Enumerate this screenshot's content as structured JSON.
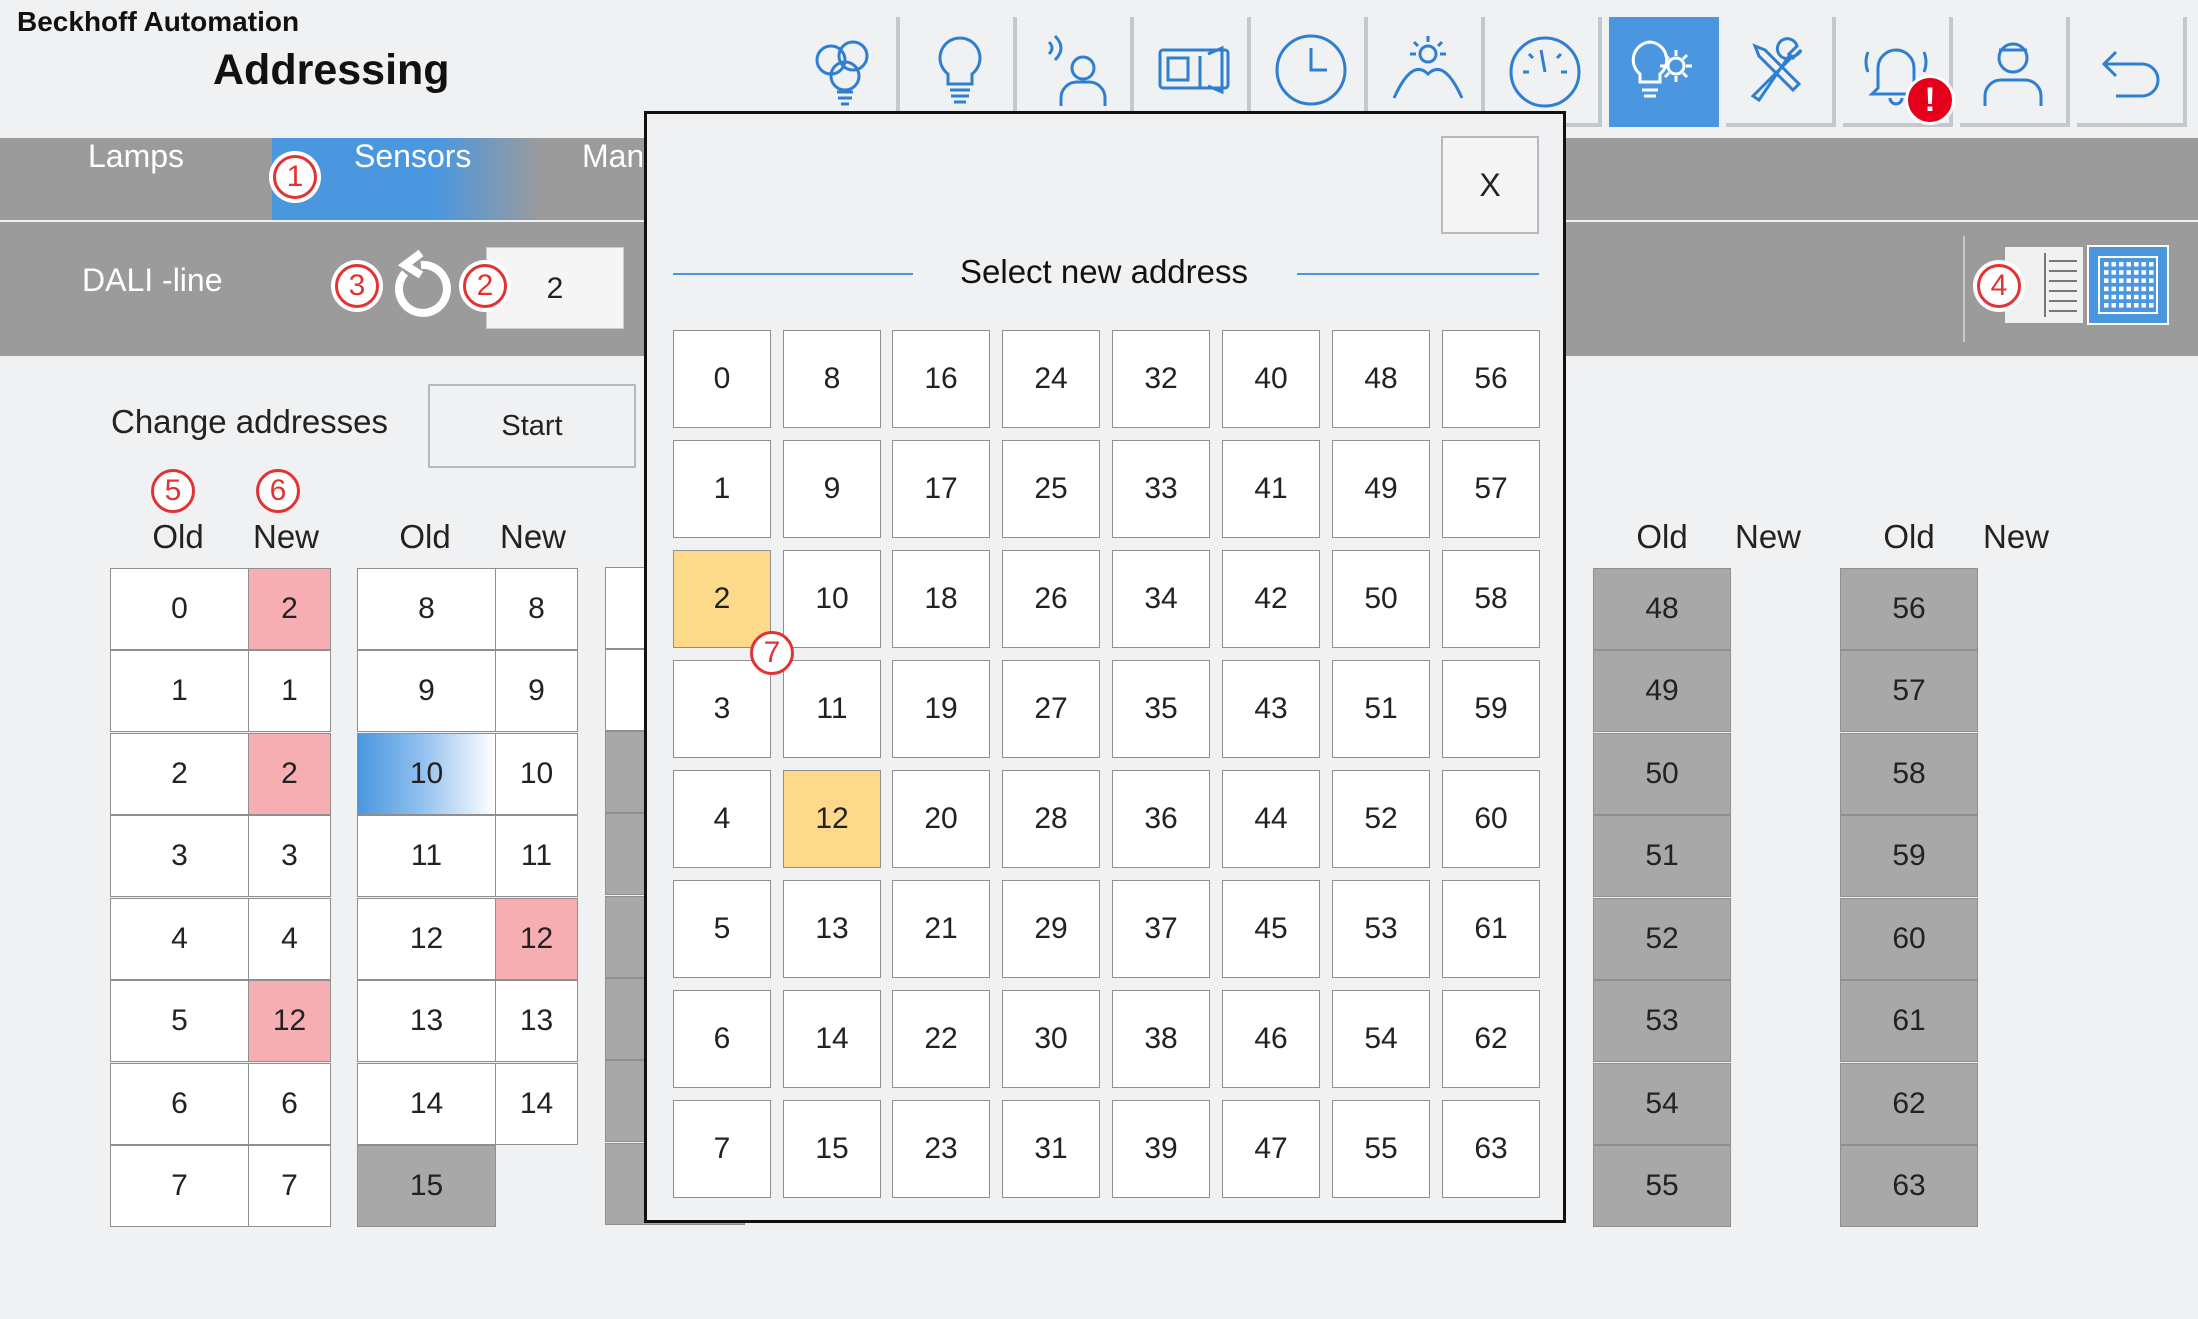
{
  "app": {
    "brand": "Beckhoff Automation",
    "title": "Addressing"
  },
  "toolbar": {
    "icons": [
      "lamp-group-icon",
      "lamp-icon",
      "sensor-person-icon",
      "projector-icon",
      "clock-icon",
      "daylight-icon",
      "gauge-icon",
      "settings-bulb-icon",
      "tools-icon",
      "alarm-bell-icon",
      "user-icon",
      "back-icon"
    ],
    "active": "settings-bulb-icon",
    "alarm_badge": "!"
  },
  "nav": {
    "tabs": [
      "Lamps",
      "Sensors",
      "Man"
    ],
    "active": "Sensors"
  },
  "dali": {
    "label": "DALI -line",
    "value": "2"
  },
  "change": {
    "label": "Change addresses",
    "start_label": "Start"
  },
  "markers": [
    "1",
    "2",
    "3",
    "4",
    "5",
    "6",
    "7"
  ],
  "tables": {
    "headers": {
      "old": "Old",
      "new": "New"
    },
    "col1": {
      "old": [
        "0",
        "1",
        "2",
        "3",
        "4",
        "5",
        "6",
        "7"
      ],
      "new": [
        "2",
        "1",
        "2",
        "3",
        "4",
        "12",
        "6",
        "7"
      ],
      "new_highlight": [
        true,
        false,
        true,
        false,
        false,
        true,
        false,
        false
      ]
    },
    "col2": {
      "old": [
        "8",
        "9",
        "10",
        "11",
        "12",
        "13",
        "14",
        "15"
      ],
      "new": [
        "8",
        "9",
        "10",
        "11",
        "12",
        "13",
        "14"
      ],
      "new_highlight": [
        false,
        false,
        false,
        false,
        true,
        false,
        false
      ],
      "selected_old": "10",
      "disabled_old": [
        "15"
      ]
    },
    "col7": {
      "old": [
        "48",
        "49",
        "50",
        "51",
        "52",
        "53",
        "54",
        "55"
      ]
    },
    "col8": {
      "old": [
        "56",
        "57",
        "58",
        "59",
        "60",
        "61",
        "62",
        "63"
      ]
    }
  },
  "modal": {
    "title": "Select new address",
    "close_label": "X",
    "addresses": [
      [
        "0",
        "8",
        "16",
        "24",
        "32",
        "40",
        "48",
        "56"
      ],
      [
        "1",
        "9",
        "17",
        "25",
        "33",
        "41",
        "49",
        "57"
      ],
      [
        "2",
        "10",
        "18",
        "26",
        "34",
        "42",
        "50",
        "58"
      ],
      [
        "3",
        "11",
        "19",
        "27",
        "35",
        "43",
        "51",
        "59"
      ],
      [
        "4",
        "12",
        "20",
        "28",
        "36",
        "44",
        "52",
        "60"
      ],
      [
        "5",
        "13",
        "21",
        "29",
        "37",
        "45",
        "53",
        "61"
      ],
      [
        "6",
        "14",
        "22",
        "30",
        "38",
        "46",
        "54",
        "62"
      ],
      [
        "7",
        "15",
        "23",
        "31",
        "39",
        "47",
        "55",
        "63"
      ]
    ],
    "highlighted": [
      "2",
      "12"
    ]
  },
  "colors": {
    "accent": "#4a97e0",
    "bar": "#9b9b9b",
    "highlight_red": "#f7aeb2",
    "highlight_yellow": "#fdd98c",
    "disabled": "#a8a8a8",
    "marker": "#e23232"
  }
}
